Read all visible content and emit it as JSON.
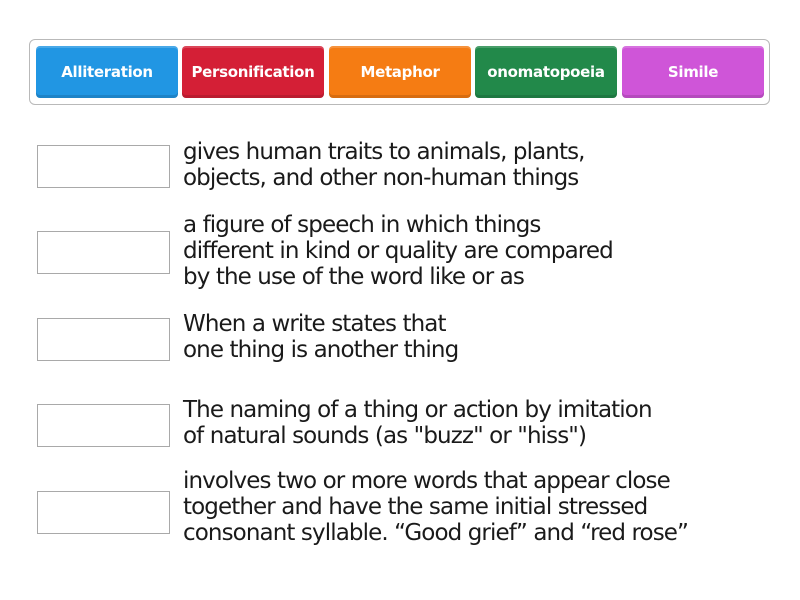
{
  "word_bank": [
    {
      "label": "Alliteration",
      "color": "#2196e3"
    },
    {
      "label": "Personification",
      "color": "#d41f36"
    },
    {
      "label": "Metaphor",
      "color": "#f57c13"
    },
    {
      "label": "onomatopoeia",
      "color": "#22894a"
    },
    {
      "label": "Simile",
      "color": "#cf55d8"
    }
  ],
  "items": [
    {
      "answer": "",
      "definition": "gives human traits to animals, plants,\nobjects, and other non-human things"
    },
    {
      "answer": "",
      "definition": "a figure of speech in which things\ndifferent in kind or quality are compared\nby the use of the word like or as"
    },
    {
      "answer": "",
      "definition": "When a write states that\none thing is another thing"
    },
    {
      "answer": "",
      "definition": "The naming of a thing or action by imitation\nof natural sounds (as \"buzz\" or \"hiss\")"
    },
    {
      "answer": "",
      "definition": "involves two or more words that appear close\ntogether and have the same initial stressed\nconsonant syllable. “Good grief” and “red rose”"
    }
  ]
}
